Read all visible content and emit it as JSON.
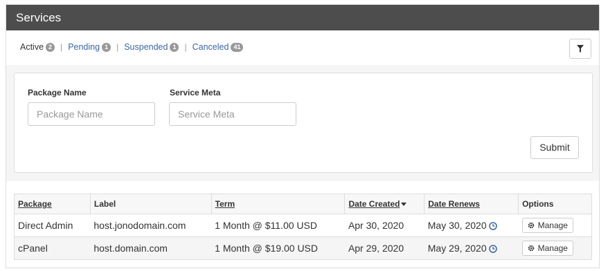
{
  "header": {
    "title": "Services"
  },
  "status_tabs": [
    {
      "label": "Active",
      "count": "2"
    },
    {
      "label": "Pending",
      "count": "1"
    },
    {
      "label": "Suspended",
      "count": "1"
    },
    {
      "label": "Canceled",
      "count": "41"
    }
  ],
  "icons": {
    "filter": "filter-icon",
    "sort": "caret-down-icon",
    "renewal": "clock-icon",
    "manage": "gear-icon"
  },
  "colors": {
    "header_bg": "#4d4d4d",
    "link": "#3a65a8",
    "badge": "#999999",
    "clock": "#3a65a8"
  },
  "filters": {
    "package_name": {
      "label": "Package Name",
      "placeholder": "Package Name",
      "value": ""
    },
    "service_meta": {
      "label": "Service Meta",
      "placeholder": "Service Meta",
      "value": ""
    },
    "submit_label": "Submit"
  },
  "table": {
    "columns": [
      "Package",
      "Label",
      "Term",
      "Date Created",
      "Date Renews",
      "Options"
    ],
    "rows": [
      {
        "package": "Direct Admin",
        "label": "host.jonodomain.com",
        "term": "1 Month @ $11.00 USD",
        "date_created": "Apr 30, 2020",
        "date_renews": "May 30, 2020",
        "action": "Manage"
      },
      {
        "package": "cPanel",
        "label": "host.domain.com",
        "term": "1 Month @ $19.00 USD",
        "date_created": "Apr 29, 2020",
        "date_renews": "May 29, 2020",
        "action": "Manage"
      }
    ]
  }
}
